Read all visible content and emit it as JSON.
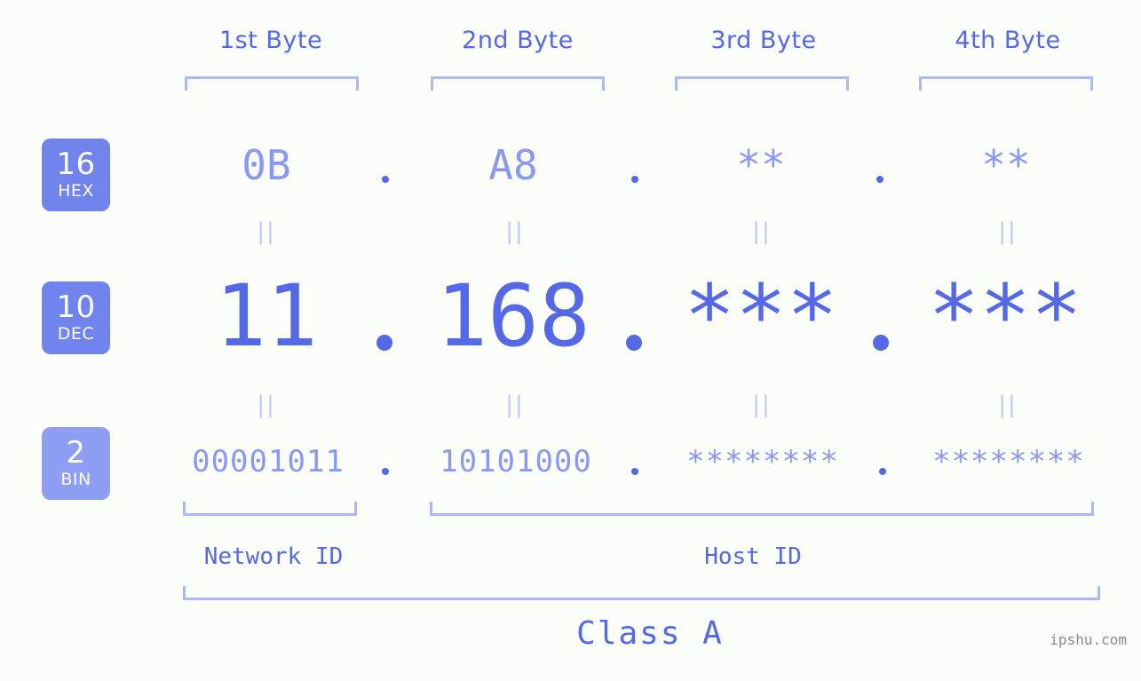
{
  "meta": {
    "background_color": "#fbfdf8",
    "accent_color": "#5468e8",
    "accent_light_color": "#8b98f2",
    "bracket_color": "#aeb8f7",
    "badge_color": "#7183ec",
    "badge_light_color": "#8e9ef4",
    "watermark_color": "#8a8a8a"
  },
  "headers": [
    {
      "label": "1st Byte"
    },
    {
      "label": "2nd Byte"
    },
    {
      "label": "3rd Byte"
    },
    {
      "label": "4th Byte"
    }
  ],
  "bases": [
    {
      "number": "16",
      "name": "HEX"
    },
    {
      "number": "10",
      "name": "DEC"
    },
    {
      "number": "2",
      "name": "BIN"
    }
  ],
  "rows": {
    "hex": {
      "base_number": "16",
      "base_name": "HEX",
      "values": [
        "0B",
        "A8",
        "**",
        "**"
      ],
      "separators": [
        ".",
        ".",
        "."
      ]
    },
    "dec": {
      "base_number": "10",
      "base_name": "DEC",
      "values": [
        "11",
        "168",
        "***",
        "***"
      ],
      "separators": [
        ".",
        ".",
        "."
      ]
    },
    "bin": {
      "base_number": "2",
      "base_name": "BIN",
      "values": [
        "00001011",
        "10101000",
        "********",
        "********"
      ],
      "separators": [
        ".",
        ".",
        "."
      ]
    }
  },
  "connectors": {
    "symbol": "||",
    "count_per_gap": 4,
    "gaps": 2
  },
  "sections": [
    {
      "label": "Network ID"
    },
    {
      "label": "Host ID"
    }
  ],
  "class": {
    "label": "Class A"
  },
  "watermark": {
    "text": "ipshu.com"
  }
}
